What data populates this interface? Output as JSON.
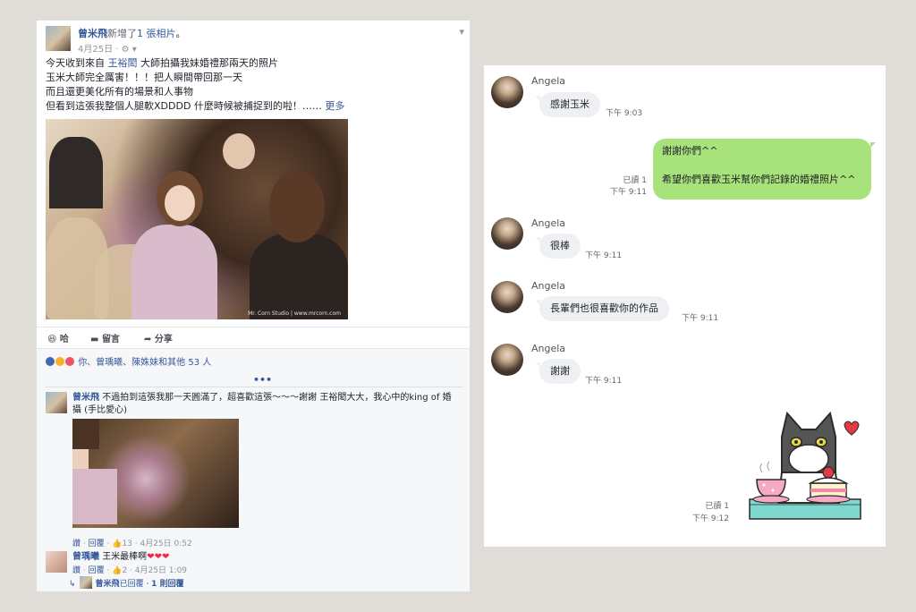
{
  "facebook_post": {
    "author": "曾米飛",
    "action_text": "新增了",
    "photo_count_link": "1 張相片",
    "action_suffix": "。",
    "date": "4月25日",
    "date_icons": "· ⚙ ▾",
    "text_line1_pre": "今天收到來自 ",
    "text_line1_link": "王裕閎",
    "text_line1_post": " 大師拍攝我妹婚禮那兩天的照片",
    "text_line2": "玉米大師完全厲害！！！把人瞬間帶回那一天",
    "text_line3": "而且還更美化所有的場景和人事物",
    "text_line4_pre": "但看到這張我整個人腿軟XDDDD 什麼時候被捕捉到的啦！…… ",
    "text_line4_link": "更多",
    "photo_watermark": "Mr. Corn Studio | www.mrcorn.com",
    "actions": {
      "like": "哈",
      "comment": "留言",
      "share": "分享"
    },
    "reactions_text": "你、曾瑀曦、陳姝妹和其他 53 人",
    "more_indicator": "•••",
    "comments": [
      {
        "author": "曾米飛",
        "text": "不過拍到這張我那一天圓滿了，超喜歡這張～～～謝謝 王裕閎大大，我心中的king of 婚攝 (手比愛心)",
        "meta_like": "讚",
        "meta_reply": "回覆",
        "meta_likes": "13",
        "meta_date": "4月25日 0:52"
      },
      {
        "author": "曾瑀曦",
        "text": "王米最棒啊",
        "hearts": "❤❤❤",
        "meta_like": "讚",
        "meta_reply": "回覆",
        "meta_likes": "2",
        "meta_date": "4月25日 1:09"
      }
    ],
    "reply_summary": {
      "author": "曾米飛",
      "action": "已回覆",
      "count": "1 則回覆"
    }
  },
  "chat": {
    "messages": [
      {
        "sender": "Angela",
        "text": "感謝玉米",
        "time": "下午 9:03"
      },
      {
        "outgoing": true,
        "line1": "謝謝你們^^",
        "line2": "希望你們喜歡玉米幫你們記錄的婚禮照片^^",
        "read": "已讀 1",
        "time": "下午 9:11"
      },
      {
        "sender": "Angela",
        "text": "很棒",
        "time": "下午 9:11"
      },
      {
        "sender": "Angela",
        "text": "長輩們也很喜歡你的作品",
        "time": "下午 9:11"
      },
      {
        "sender": "Angela",
        "text": "謝謝",
        "time": "下午 9:11"
      },
      {
        "sticker": "cat-with-cake-sticker",
        "read": "已讀 1",
        "time": "下午 9:12"
      }
    ]
  },
  "colors": {
    "fb_link": "#365899",
    "chat_outgoing": "#a7e27a",
    "chat_incoming": "#eef0f3",
    "background": "#e0ddd8"
  }
}
